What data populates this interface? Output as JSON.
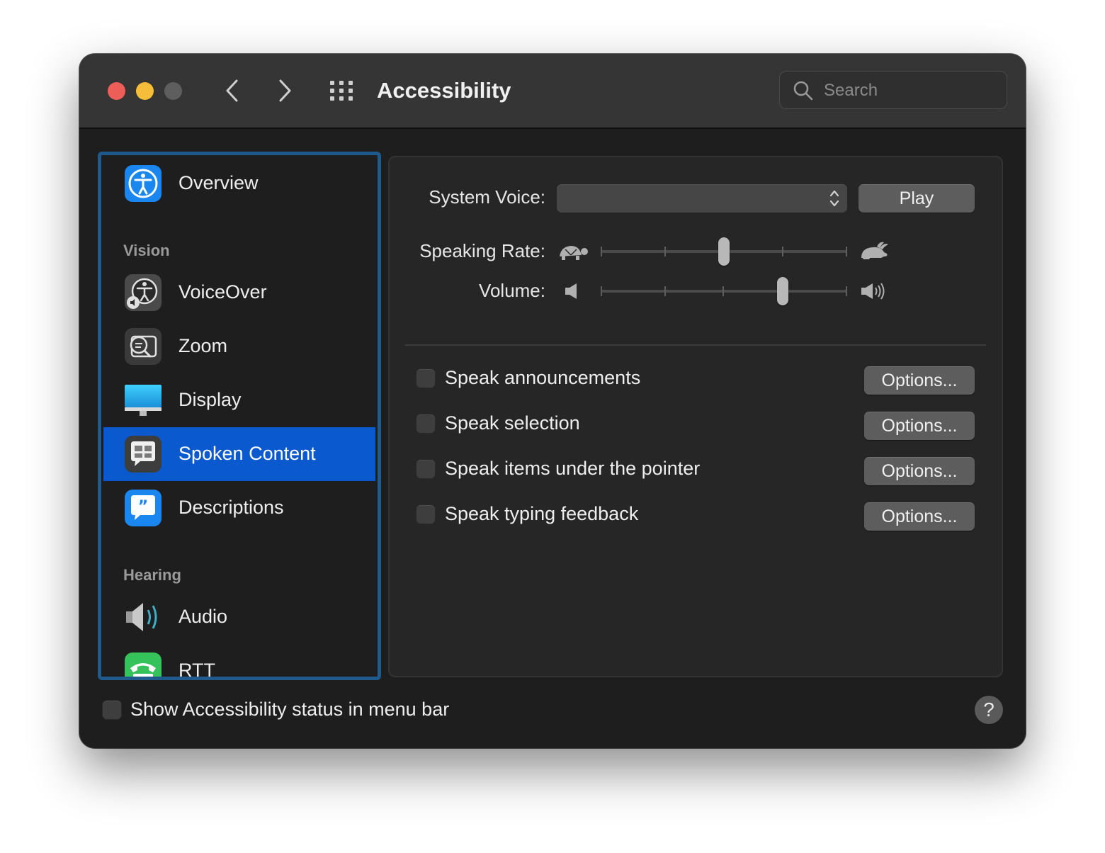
{
  "window": {
    "title": "Accessibility"
  },
  "toolbar": {
    "back_icon": "chevron-left-icon",
    "forward_icon": "chevron-right-icon",
    "grid_icon": "show-all-grid-icon"
  },
  "search": {
    "placeholder": "Search",
    "value": ""
  },
  "sidebar": {
    "items": [
      {
        "label": "Overview",
        "icon": "accessibility-person-icon"
      },
      {
        "label": "VoiceOver",
        "icon": "voiceover-icon"
      },
      {
        "label": "Zoom",
        "icon": "zoom-magnifier-icon"
      },
      {
        "label": "Display",
        "icon": "display-monitor-icon"
      },
      {
        "label": "Spoken Content",
        "icon": "speech-bubble-icon",
        "selected": true
      },
      {
        "label": "Descriptions",
        "icon": "quote-bubble-icon"
      },
      {
        "label": "Audio",
        "icon": "speaker-icon"
      },
      {
        "label": "RTT",
        "icon": "telephone-icon"
      }
    ],
    "sections": {
      "vision": "Vision",
      "hearing": "Hearing"
    }
  },
  "content": {
    "system_voice_label": "System Voice:",
    "system_voice_value": "",
    "play_label": "Play",
    "speaking_rate_label": "Speaking Rate:",
    "speaking_rate_value": 0.5,
    "volume_label": "Volume:",
    "volume_value": 0.75,
    "options": [
      {
        "label": "Speak announcements",
        "checked": false,
        "button": "Options..."
      },
      {
        "label": "Speak selection",
        "checked": false,
        "button": "Options..."
      },
      {
        "label": "Speak items under the pointer",
        "checked": false,
        "button": "Options..."
      },
      {
        "label": "Speak typing feedback",
        "checked": false,
        "button": "Options..."
      }
    ]
  },
  "footer": {
    "status_label": "Show Accessibility status in menu bar",
    "status_checked": false,
    "help_label": "?"
  },
  "colors": {
    "selection": "#0a59cf",
    "sidebar_focus_ring": "#1f5a8c",
    "close": "#ed5e58",
    "minimize": "#f6bd3a"
  }
}
